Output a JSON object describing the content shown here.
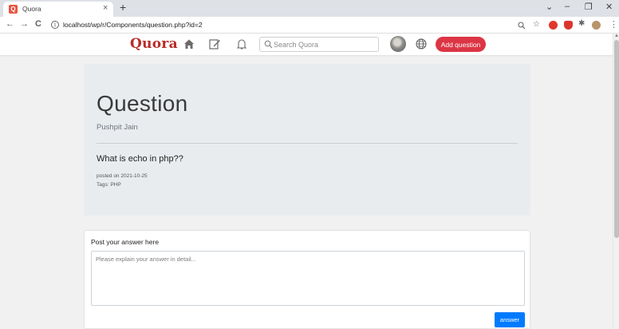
{
  "browser": {
    "tab_title": "Quora",
    "tab_close": "×",
    "new_tab": "+",
    "url": "localhost/wp/r/Components/question.php?id=2",
    "nav": {
      "back": "←",
      "forward": "→",
      "reload": "C"
    },
    "window_controls": {
      "dropdown": "⌄",
      "minimize": "–",
      "restore": "❐",
      "close": "✕"
    },
    "menu": "⋮",
    "favicon_letter": "Q"
  },
  "site": {
    "brand": "Quora",
    "brand_color": "#b92b27",
    "search": {
      "placeholder": "Search Quora",
      "value": ""
    },
    "add_question_label": "Add question",
    "add_question_color": "#dc3545",
    "icons": [
      "home-icon",
      "edit-icon",
      "bell-icon",
      "search-icon",
      "avatar",
      "globe-icon"
    ]
  },
  "question": {
    "heading": "Question",
    "author": "Pushpit Jain",
    "title": "What is echo in php??",
    "posted_on": "posted on 2021-10-25",
    "tags": "Tags: PHP"
  },
  "answer_form": {
    "label": "Post your answer here",
    "textarea_placeholder": "Please explain your answer in detail...",
    "textarea_value": "",
    "submit_label": "answer",
    "submit_color": "#007bff"
  }
}
